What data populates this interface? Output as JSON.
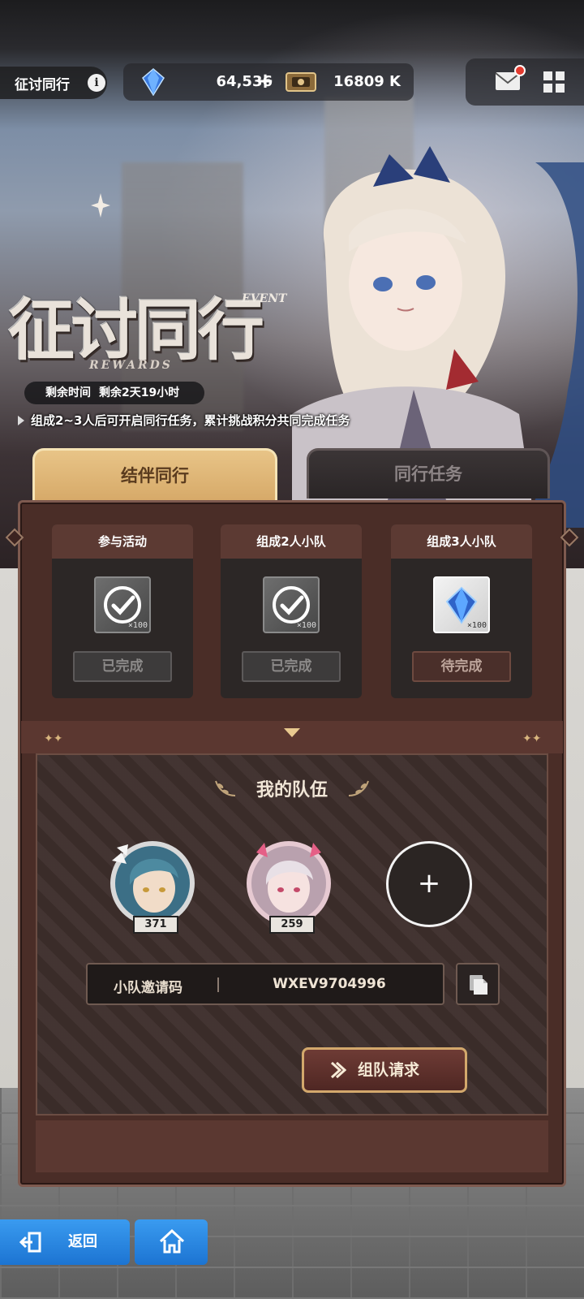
{
  "header": {
    "title": "征讨同行",
    "info_icon": "i",
    "gem_value": "64,536",
    "plus_label": "+",
    "ticket_value": "16809 K"
  },
  "event": {
    "logo_text": "征讨同行",
    "logo_event": "EVENT",
    "logo_rewards": "REWARDS",
    "time_label": "剩余时间",
    "time_value": "剩余2天19小时",
    "description": "组成2~3人后可开启同行任务，累计挑战积分共同完成任务"
  },
  "tabs": [
    {
      "label": "结伴同行",
      "active": true
    },
    {
      "label": "同行任务",
      "active": false
    }
  ],
  "rewards": [
    {
      "title": "参与活动",
      "item": "check-item",
      "count": "×100",
      "status": "已完成"
    },
    {
      "title": "组成2人小队",
      "item": "check-item",
      "count": "×100",
      "status": "已完成"
    },
    {
      "title": "组成3人小队",
      "item": "gem-item",
      "count": "×100",
      "status": "待完成"
    }
  ],
  "team": {
    "title": "我的队伍",
    "members": [
      {
        "level": "371"
      },
      {
        "level": "259"
      }
    ],
    "add_label": "+",
    "invite_label": "小队邀请码",
    "invite_code": "WXEV9704996",
    "request_label": "组队请求"
  },
  "nav": {
    "back_label": "返回"
  },
  "colors": {
    "accent_gold": "#e8c487",
    "panel": "#4a2d27",
    "nav_blue": "#2a88e4",
    "notify_red": "#e33b2f"
  }
}
